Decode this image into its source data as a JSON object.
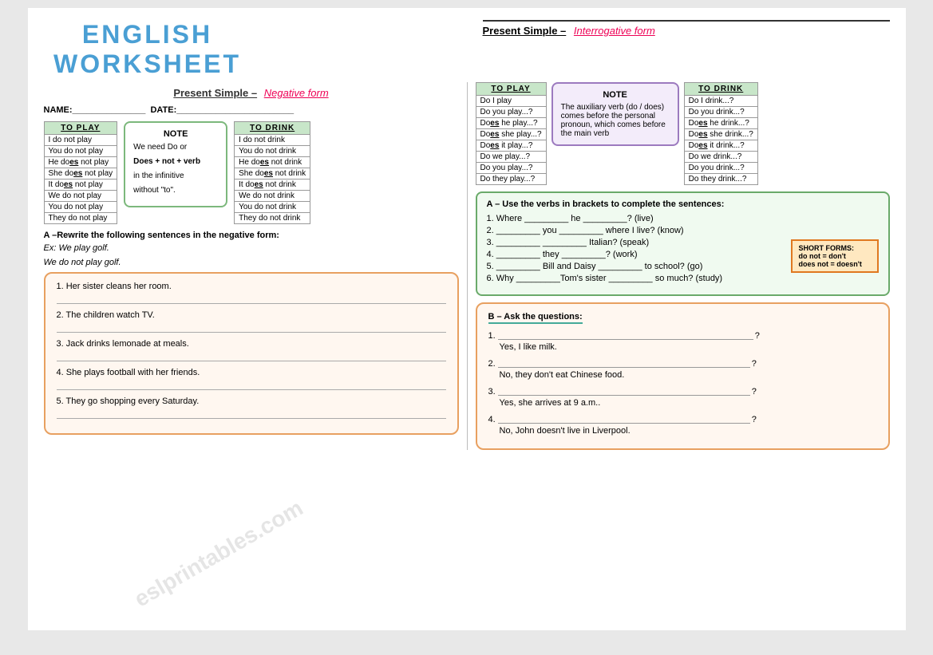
{
  "title": "ENGLISH  WORKSHEET",
  "left": {
    "section_title_prefix": "Present Simple –",
    "section_title_form": "Negative form",
    "name_label": "NAME:_______________",
    "date_label": "DATE:________________________",
    "play_table": {
      "header": "TO  PLAY",
      "rows": [
        "I do not play",
        "You do not play",
        "He does not play",
        "She does not play",
        "It does not play",
        "We do not play",
        "You do not play",
        "They do not play"
      ]
    },
    "drink_table": {
      "header": "TO  DRINK",
      "rows": [
        "I do not drink",
        "You do not drink",
        "He does not drink",
        "She does not drink",
        "It does not drink",
        "We do not drink",
        "You do not drink",
        "They do not drink"
      ]
    },
    "note": {
      "title": "NOTE",
      "line1": "We need Do or",
      "line2": "Does + not + verb",
      "line3": "in the infinitive",
      "line4": "without \"to\"."
    },
    "rewrite_instr": "A –Rewrite the following sentences in the negative form:",
    "example_q": "Ex: We play golf.",
    "example_a": "    We do not play golf.",
    "exercise_items": [
      "1. Her sister cleans her room.",
      "2. The children watch TV.",
      "3. Jack drinks lemonade at meals.",
      "4. She plays football with her friends.",
      "5. They go shopping every Saturday."
    ]
  },
  "right": {
    "section_title_prefix": "Present Simple –",
    "section_title_form": "Interrogative form",
    "play_table": {
      "header": "TO  PLAY",
      "rows": [
        "Do I play",
        "Do you play...?",
        "Does he play...?",
        "Does she play...?",
        "Does it play...?",
        "Do we play...?",
        "Do you play...?",
        "Do they play...?"
      ]
    },
    "drink_table": {
      "header": "TO  DRINK",
      "rows": [
        "Do I drink...?",
        "Do you drink...?",
        "Does he drink...?",
        "Does she drink...?",
        "Does it drink...?",
        "Do we drink...?",
        "Do you drink...?",
        "Do they drink...?"
      ]
    },
    "note": {
      "title": "NOTE",
      "text": "The auxiliary verb (do / does) comes before the personal pronoun, which comes before the main verb"
    },
    "section_a_instr": "A – Use the verbs in brackets to complete the sentences:",
    "section_a_items": [
      "1. Where _________ he _________? (live)",
      "2. _________ you _________ where I live? (know)",
      "3. _________ _________ Italian? (speak)",
      "4. _________ they _________? (work)",
      "5. _________ Bill and Daisy _________ to school? (go)",
      "6. Why _________Tom's sister _________ so much? (study)"
    ],
    "short_forms": {
      "title": "SHORT FORMS:",
      "line1": "do not = don't",
      "line2": "does not = doesn't"
    },
    "section_b_instr": "B – Ask the questions:",
    "section_b_items": [
      {
        "answer": "Yes, I like milk."
      },
      {
        "answer": "No, they don't eat Chinese food."
      },
      {
        "answer": "Yes, she arrives at 9 a.m.."
      },
      {
        "answer": "No, John doesn't live in Liverpool."
      }
    ]
  },
  "watermark": "eslprintables.com"
}
